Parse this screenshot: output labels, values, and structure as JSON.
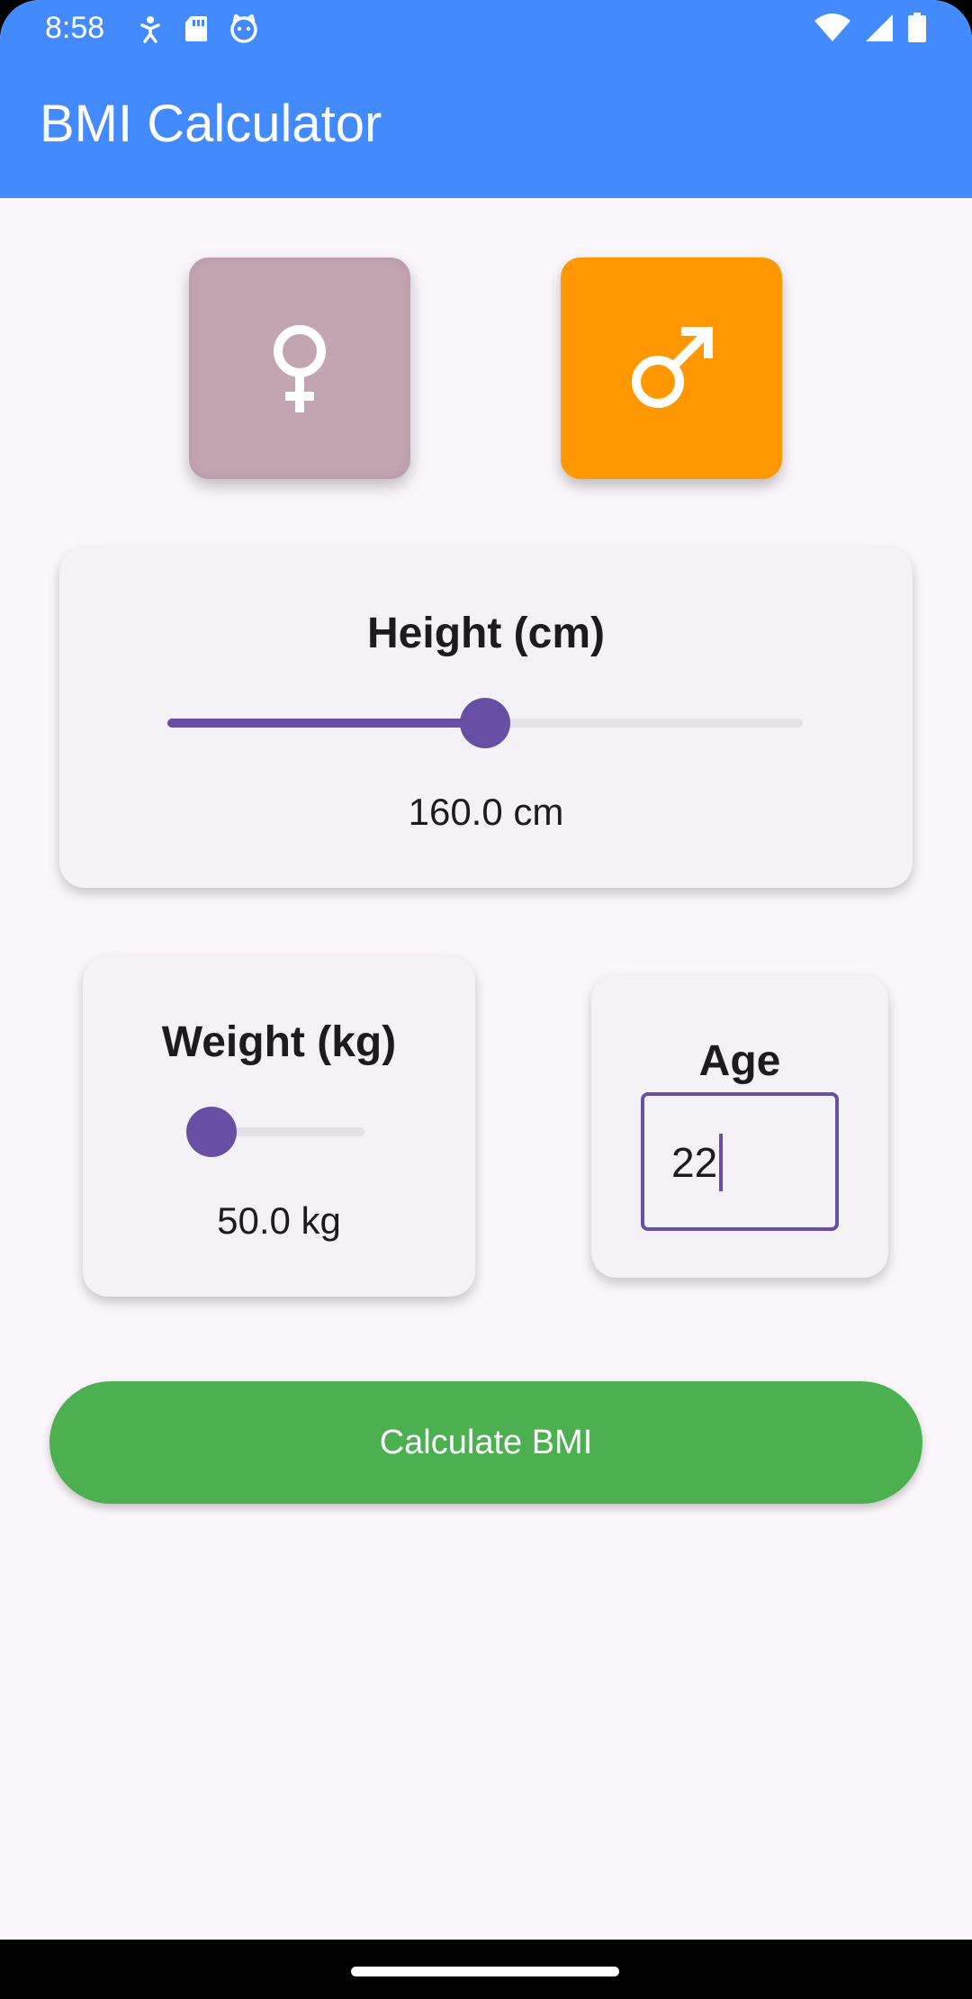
{
  "status_bar": {
    "time": "8:58",
    "left_icons": [
      "accessibility-icon",
      "sd-card-icon",
      "cat-face-icon"
    ],
    "right_icons": [
      "wifi-icon",
      "signal-icon",
      "battery-icon"
    ]
  },
  "app_bar": {
    "title": "BMI Calculator",
    "color": "#448aff"
  },
  "gender": {
    "female": {
      "icon": "female-symbol-icon",
      "selected": false,
      "color": "#c2a5b0"
    },
    "male": {
      "icon": "male-symbol-icon",
      "selected": true,
      "color": "#ff9800"
    }
  },
  "height": {
    "title": "Height (cm)",
    "value_text": "160.0 cm",
    "slider_fraction": 0.5
  },
  "weight": {
    "title": "Weight (kg)",
    "value_text": "50.0 kg",
    "slider_fraction": 0.0
  },
  "age": {
    "title": "Age",
    "value": "22"
  },
  "calculate_button": {
    "label": "Calculate BMI",
    "color": "#4caf50"
  },
  "accent_color": "#6750a4"
}
